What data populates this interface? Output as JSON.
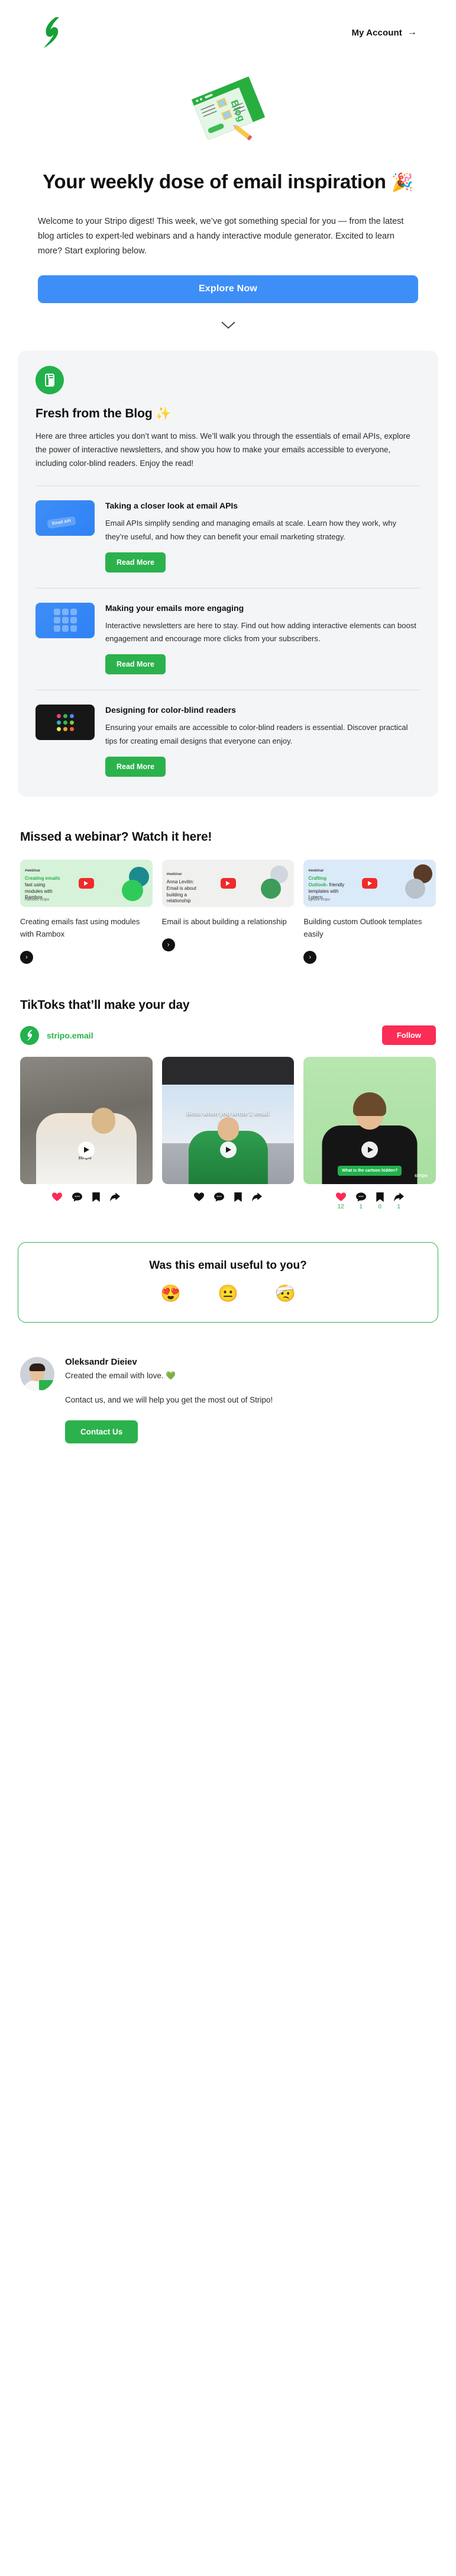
{
  "colors": {
    "brand_green": "#2bb24c",
    "cta_blue": "#3e8ef7",
    "tiktok_red": "#fb2c55",
    "card_grey": "#f4f5f6",
    "text_dark": "#111111"
  },
  "header": {
    "logo_alt": "Stripo logo",
    "account_label": "My Account",
    "account_arrow": "→"
  },
  "hero": {
    "illustration_label": "Blog",
    "title": "Your weekly dose of email inspiration",
    "title_emoji": "🎉",
    "body": "Welcome to your Stripo digest! This week, we’ve got something special for you — from the latest blog articles to expert-led webinars and a handy interactive module generator. Excited to learn more? Start exploring below.",
    "cta_label": "Explore Now"
  },
  "blog": {
    "heading": "Fresh from the Blog",
    "heading_emoji": "✨",
    "intro": "Here are three articles you don’t want to miss. We’ll walk you through the essentials of email APIs, explore the power of interactive newsletters, and show you how to make your emails accessible to everyone, including color-blind readers. Enjoy the read!",
    "articles": [
      {
        "thumb_label": "Email API",
        "title": "Taking a closer look at email APIs",
        "text": "Email APIs simplify sending and managing emails at scale. Learn how they work, why they’re useful, and how they can benefit your email marketing strategy.",
        "button": "Read More"
      },
      {
        "thumb_label": "",
        "title": "Making your emails more engaging",
        "text": "Interactive newsletters are here to stay. Find out how adding interactive elements can boost engagement and encourage more clicks from your subscribers.",
        "button": "Read More"
      },
      {
        "thumb_label": "",
        "title": "Designing for color-blind readers",
        "text": "Ensuring your emails are accessible to color-blind readers is essential. Discover practical tips for creating email designs that everyone can enjoy.",
        "button": "Read More"
      }
    ]
  },
  "webinars": {
    "title": "Missed a webinar? Watch it here!",
    "items": [
      {
        "tag": "#webinar",
        "thumb_headline_green": "Creating emails",
        "thumb_headline_rest": "fast using modules with Rambox",
        "brand": "Rambox   stripo",
        "caption": "Creating emails fast using modules with Rambox",
        "arrow": "›"
      },
      {
        "tag": "#webinar",
        "thumb_headline_green": "",
        "thumb_headline_rest": "Anna Levitin: Email is about building a relationship",
        "brand": "",
        "caption": "Email is about building a relationship",
        "arrow": "›"
      },
      {
        "tag": "#webinar",
        "thumb_headline_green": "Crafting Outlook-",
        "thumb_headline_rest": "friendly templates with Lyreco",
        "brand": "Lyreco   stripo",
        "caption": "Building custom Outlook templates easily",
        "arrow": "›"
      }
    ]
  },
  "tiktok": {
    "title": "TikToks that’ll make your day",
    "handle": "stripo.email",
    "follow_label": "Follow",
    "videos": [
      {
        "caption": "",
        "badge": "",
        "watermark": "stripo",
        "actions": [
          {
            "icon": "heart-icon",
            "count": ""
          },
          {
            "icon": "comment-icon",
            "count": ""
          },
          {
            "icon": "bookmark-icon",
            "count": ""
          },
          {
            "icon": "share-icon",
            "count": ""
          }
        ]
      },
      {
        "caption": "Boss when you wrote 1 email",
        "badge": "",
        "watermark": "",
        "actions": [
          {
            "icon": "heart-icon",
            "count": ""
          },
          {
            "icon": "comment-icon",
            "count": ""
          },
          {
            "icon": "bookmark-icon",
            "count": ""
          },
          {
            "icon": "share-icon",
            "count": ""
          }
        ]
      },
      {
        "caption": "",
        "badge": "What is the cartoon hidden?",
        "watermark": "stripo",
        "actions": [
          {
            "icon": "heart-icon",
            "count": "12"
          },
          {
            "icon": "comment-icon",
            "count": "1"
          },
          {
            "icon": "bookmark-icon",
            "count": "0"
          },
          {
            "icon": "share-icon",
            "count": "1"
          }
        ]
      }
    ]
  },
  "feedback": {
    "question": "Was this email useful to you?",
    "options": [
      {
        "emoji": "😍",
        "name": "love-it"
      },
      {
        "emoji": "😐",
        "name": "neutral"
      },
      {
        "emoji": "🤕",
        "name": "not-useful"
      }
    ]
  },
  "signature": {
    "name": "Oleksandr Dieiev",
    "tagline": "Created the email with love.",
    "tagline_emoji": "💚",
    "contact_text": "Contact us, and we will help you get the most out of Stripo!",
    "button": "Contact Us"
  }
}
